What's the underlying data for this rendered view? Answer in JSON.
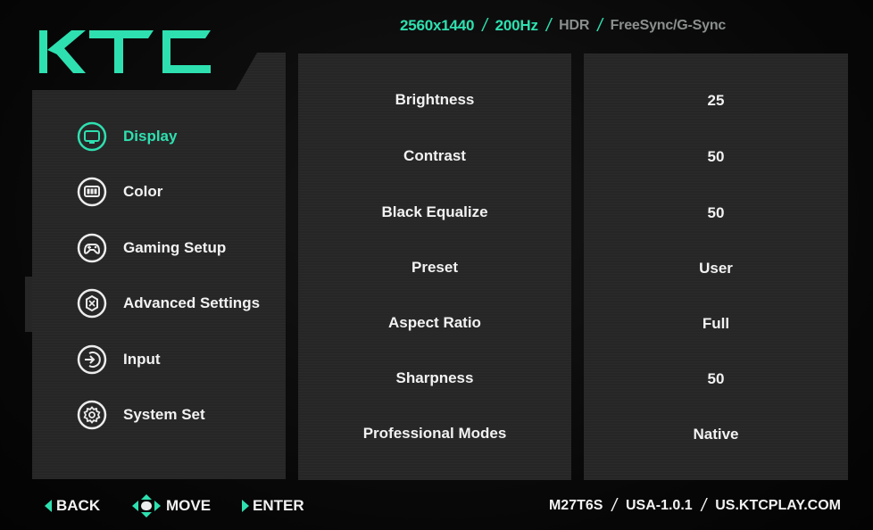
{
  "brand": {
    "logo_text": "KTC",
    "accent_color": "#2ee0b0"
  },
  "header": {
    "resolution": "2560x1440",
    "refresh_rate": "200Hz",
    "hdr": "HDR",
    "sync": "FreeSync/G-Sync",
    "separator": "/"
  },
  "menu": {
    "items": [
      {
        "label": "Display",
        "icon": "monitor-icon",
        "active": true
      },
      {
        "label": "Color",
        "icon": "color-icon",
        "active": false
      },
      {
        "label": "Gaming Setup",
        "icon": "gamepad-icon",
        "active": false
      },
      {
        "label": "Advanced Settings",
        "icon": "advanced-settings-icon",
        "active": false
      },
      {
        "label": "Input",
        "icon": "input-icon",
        "active": false
      },
      {
        "label": "System Set",
        "icon": "gear-icon",
        "active": false
      }
    ]
  },
  "settings": [
    {
      "label": "Brightness",
      "value": "25"
    },
    {
      "label": "Contrast",
      "value": "50"
    },
    {
      "label": "Black Equalize",
      "value": "50"
    },
    {
      "label": "Preset",
      "value": "User"
    },
    {
      "label": "Aspect Ratio",
      "value": "Full"
    },
    {
      "label": "Sharpness",
      "value": "50"
    },
    {
      "label": "Professional Modes",
      "value": "Native"
    }
  ],
  "footer": {
    "back": "BACK",
    "move": "MOVE",
    "enter": "ENTER",
    "model": "M27T6S",
    "firmware": "USA-1.0.1",
    "website": "US.KTCPLAY.COM",
    "separator": "/"
  }
}
